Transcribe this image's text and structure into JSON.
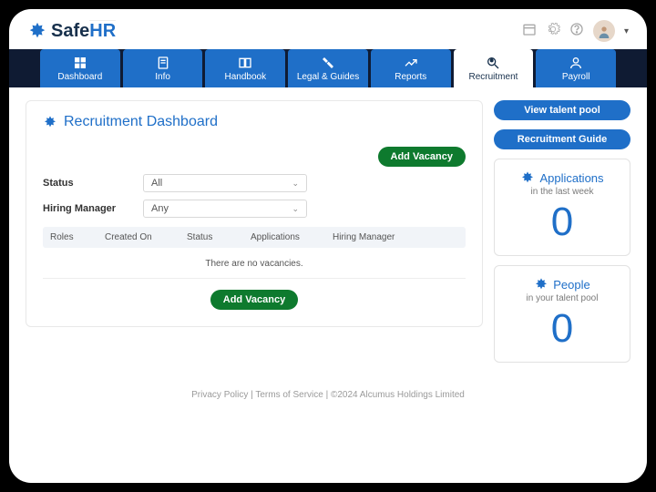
{
  "brand": {
    "name_left": "Safe",
    "name_right": "HR"
  },
  "nav": {
    "tabs": [
      {
        "label": "Dashboard"
      },
      {
        "label": "Info"
      },
      {
        "label": "Handbook"
      },
      {
        "label": "Legal & Guides"
      },
      {
        "label": "Reports"
      },
      {
        "label": "Recruitment"
      },
      {
        "label": "Payroll"
      }
    ],
    "active_index": 5
  },
  "page": {
    "title": "Recruitment Dashboard",
    "add_vacancy_label": "Add Vacancy",
    "filter_status_label": "Status",
    "filter_status_value": "All",
    "filter_manager_label": "Hiring Manager",
    "filter_manager_value": "Any",
    "columns": {
      "roles": "Roles",
      "created": "Created On",
      "status": "Status",
      "apps": "Applications",
      "manager": "Hiring Manager"
    },
    "empty_message": "There are no vacancies."
  },
  "side": {
    "view_talent_pool": "View talent pool",
    "recruitment_guide": "Recruitment Guide",
    "apps_card": {
      "title": "Applications",
      "sub": "in the last week",
      "value": "0"
    },
    "people_card": {
      "title": "People",
      "sub": "in your talent pool",
      "value": "0"
    }
  },
  "footer": {
    "text": "Privacy Policy | Terms of Service | ©2024 Alcumus Holdings Limited"
  }
}
